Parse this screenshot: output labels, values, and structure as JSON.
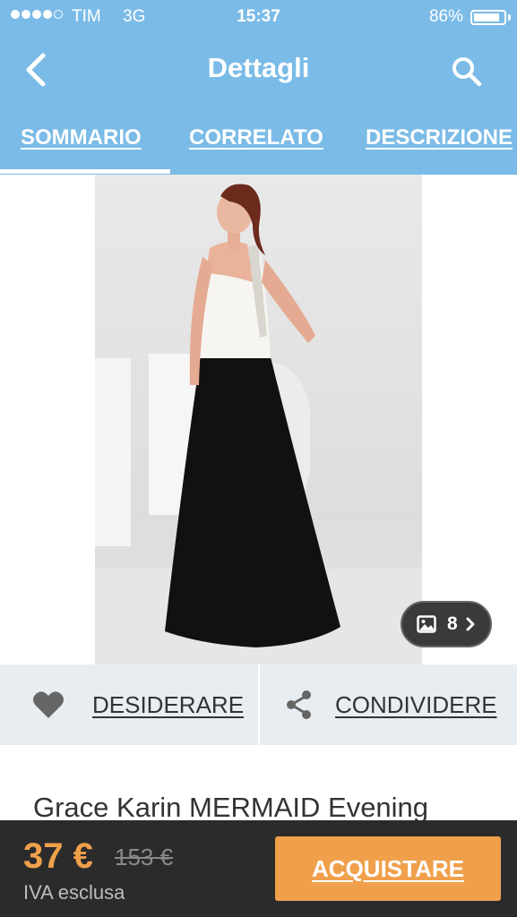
{
  "status_bar": {
    "carrier": "TIM",
    "network": "3G",
    "time": "15:37",
    "battery": "86%",
    "battery_level": 0.86,
    "signal_bars": 4
  },
  "header": {
    "title": "Dettagli",
    "back_icon": "chevron-left-icon",
    "search_icon": "search-icon"
  },
  "tabs": [
    {
      "label": "SOMMARIO",
      "active": true
    },
    {
      "label": "CORRELATO",
      "active": false
    },
    {
      "label": "DESCRIZIONE",
      "active": false
    }
  ],
  "gallery": {
    "count": "8",
    "icon": "image-icon"
  },
  "actions": {
    "wishlist_label": "DESIDERARE",
    "share_label": "CONDIVIDERE"
  },
  "product": {
    "title": "Grace Karin MERMAID Evening"
  },
  "purchase": {
    "price": "37 €",
    "old_price": "153 €",
    "tax_note": "IVA esclusa",
    "buy_label": "ACQUISTARE"
  },
  "colors": {
    "header": "#7bbbe7",
    "accent": "#f0a04b",
    "bottom_bar": "#2b2b2b"
  }
}
